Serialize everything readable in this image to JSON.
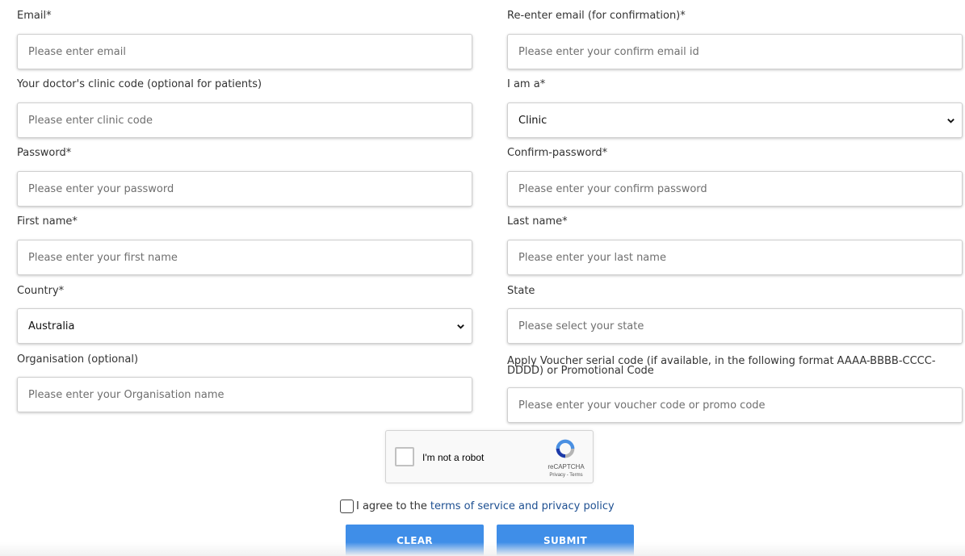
{
  "form": {
    "email": {
      "label": "Email*",
      "placeholder": "Please enter email"
    },
    "confirm_email": {
      "label": "Re-enter email (for confirmation)*",
      "placeholder": "Please enter your confirm email id"
    },
    "clinic_code": {
      "label": "Your doctor's clinic code (optional for patients)",
      "placeholder": "Please enter clinic code"
    },
    "role": {
      "label": "I am a*",
      "value": "Clinic"
    },
    "password": {
      "label": "Password*",
      "placeholder": "Please enter your password"
    },
    "confirm_password": {
      "label": "Confirm-password*",
      "placeholder": "Please enter your confirm password"
    },
    "first_name": {
      "label": "First name*",
      "placeholder": "Please enter your first name"
    },
    "last_name": {
      "label": "Last name*",
      "placeholder": "Please enter your last name"
    },
    "country": {
      "label": "Country*",
      "value": "Australia"
    },
    "state": {
      "label": "State",
      "placeholder": "Please select your state"
    },
    "organisation": {
      "label": "Organisation (optional)",
      "placeholder": "Please enter your Organisation name"
    },
    "voucher": {
      "label": "Apply Voucher serial code (if available, in the following format AAAA-BBBB-CCCC-DDDD) or Promotional Code",
      "placeholder": "Please enter your voucher code or promo code"
    }
  },
  "captcha": {
    "label": "I'm not a robot",
    "brand": "reCAPTCHA",
    "links": "Privacy - Terms"
  },
  "agreement": {
    "prefix": "I agree to the",
    "link_text": "terms of service and privacy policy"
  },
  "buttons": {
    "clear": "CLEAR",
    "submit": "SUBMIT"
  },
  "colors": {
    "button": "#3f8ee8",
    "link": "#1d4f91",
    "captcha_blue": "#4a90e2",
    "captcha_grey": "#b4b4b4"
  },
  "icons": {
    "select_chevron": "chevron-down-icon",
    "captcha_logo": "recaptcha-logo-icon"
  }
}
